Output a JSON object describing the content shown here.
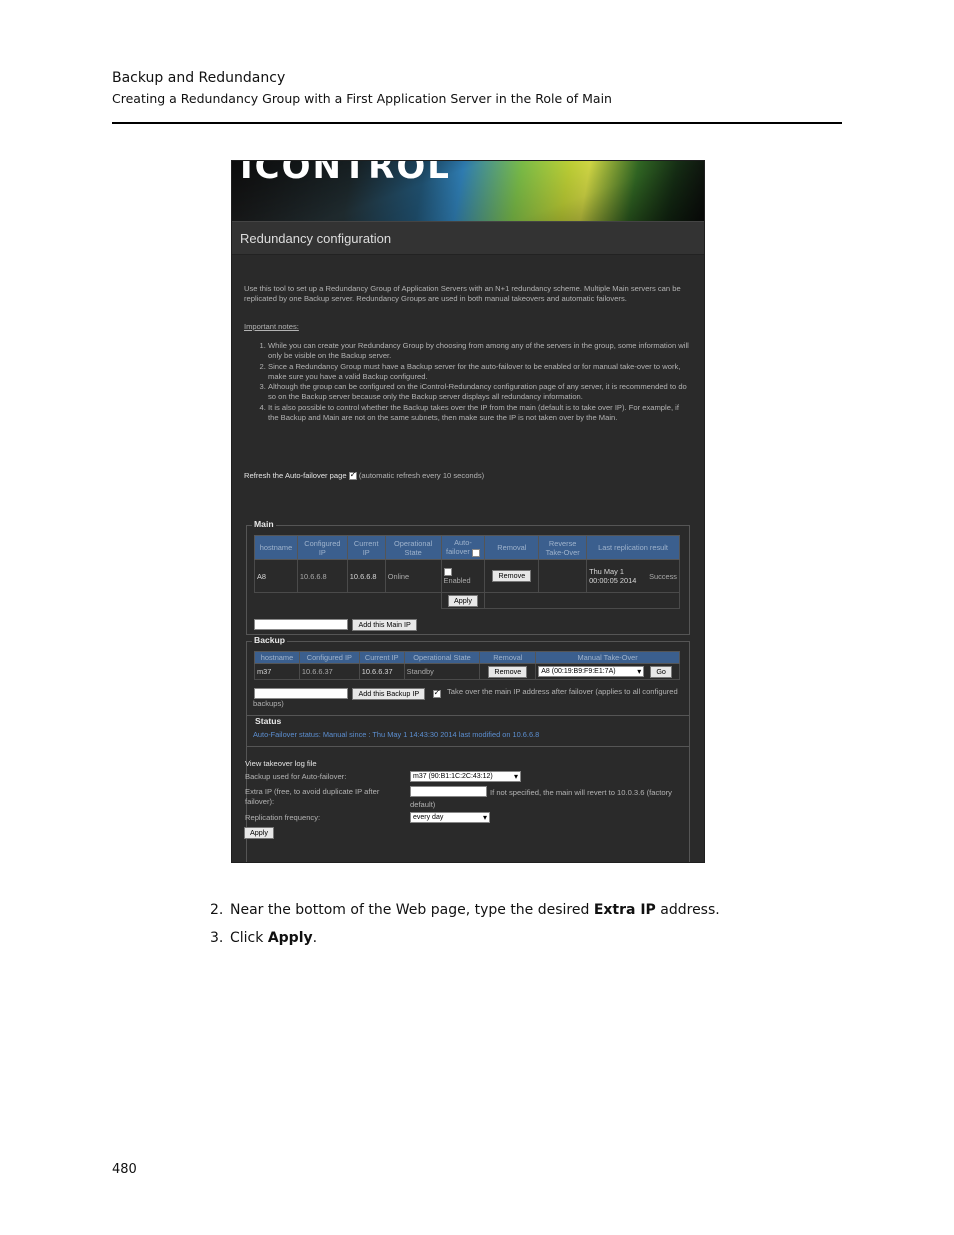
{
  "doc": {
    "title": "Backup and Redundancy",
    "subtitle": "Creating a Redundancy Group with a First Application Server in the Role of Main",
    "page_number": "480"
  },
  "screenshot": {
    "logo": "ICONTROL",
    "page_title": "Redundancy configuration",
    "intro": "Use this tool to set up a Redundancy Group of Application Servers with an N+1 redundancy scheme. Multiple Main servers can be replicated by one Backup server. Redundancy Groups are used in both manual takeovers and automatic failovers.",
    "notes_heading": "Important notes:",
    "notes": [
      "While you can create your Redundancy Group by choosing from among any of the servers in the group, some information will only be visible on the Backup server.",
      "Since a Redundancy Group must have a Backup server for the auto-failover to be enabled or for manual take-over to work, make sure you have a valid Backup configured.",
      "Although the group can be configured on the iControl-Redundancy configuration page of any server, it is recommended to do so on the Backup server because only the Backup server displays all redundancy information.",
      "It is also possible to control whether the Backup takes over the IP from the main (default is to take over IP). For example, if the Backup and Main are not on the same subnets, then make sure the IP is not taken over by the Main."
    ],
    "refresh_label": "Refresh the Auto-failover page",
    "refresh_hint": "(automatic refresh every 10 seconds)",
    "main": {
      "legend": "Main",
      "headers": [
        "hostname",
        "Configured IP",
        "Current IP",
        "Operational State",
        "Auto-failover",
        "Removal",
        "Reverse Take-Over",
        "Last replication result"
      ],
      "row": {
        "hostname": "A8",
        "configured_ip": "10.6.6.8",
        "current_ip": "10.6.6.8",
        "state": "Online",
        "auto_failover": "Enabled",
        "removal_button": "Remove",
        "last_replication": "Thu May 1 00:00:05 2014",
        "result": "Success"
      },
      "apply_button": "Apply",
      "add_button": "Add this Main IP"
    },
    "backup": {
      "legend": "Backup",
      "headers": [
        "hostname",
        "Configured IP",
        "Current IP",
        "Operational State",
        "Removal",
        "Manual Take-Over"
      ],
      "row": {
        "hostname": "m37",
        "configured_ip": "10.6.6.37",
        "current_ip": "10.6.6.37",
        "state": "Standby",
        "removal_button": "Remove",
        "takeover_select": "A8 (00:19:B9:F9:E1:7A)",
        "go_button": "Go"
      },
      "add_button": "Add this Backup IP",
      "takeover_label": "Take over the main IP address after failover (applies to all configured backups)"
    },
    "status": {
      "legend": "Status",
      "text": "Auto-Failover status: Manual since : Thu May 1 14:43:30 2014 last modified on 10.6.6.8"
    },
    "settings": {
      "log_link": "View takeover log file",
      "backup_label": "Backup used for Auto-failover:",
      "backup_value": "m37 (90:B1:1C:2C:43:12)",
      "extra_ip_label": "Extra IP (free, to avoid duplicate IP after failover):",
      "extra_ip_hint": "If not specified, the main will revert to 10.0.3.6 (factory default)",
      "replication_label": "Replication frequency:",
      "replication_value": "every day",
      "apply_button": "Apply"
    }
  },
  "steps": [
    {
      "num": "2.",
      "pre": "Near the bottom of the Web page, type the desired ",
      "bold": "Extra IP",
      "post": " address."
    },
    {
      "num": "3.",
      "pre": "Click ",
      "bold": "Apply",
      "post": "."
    }
  ]
}
